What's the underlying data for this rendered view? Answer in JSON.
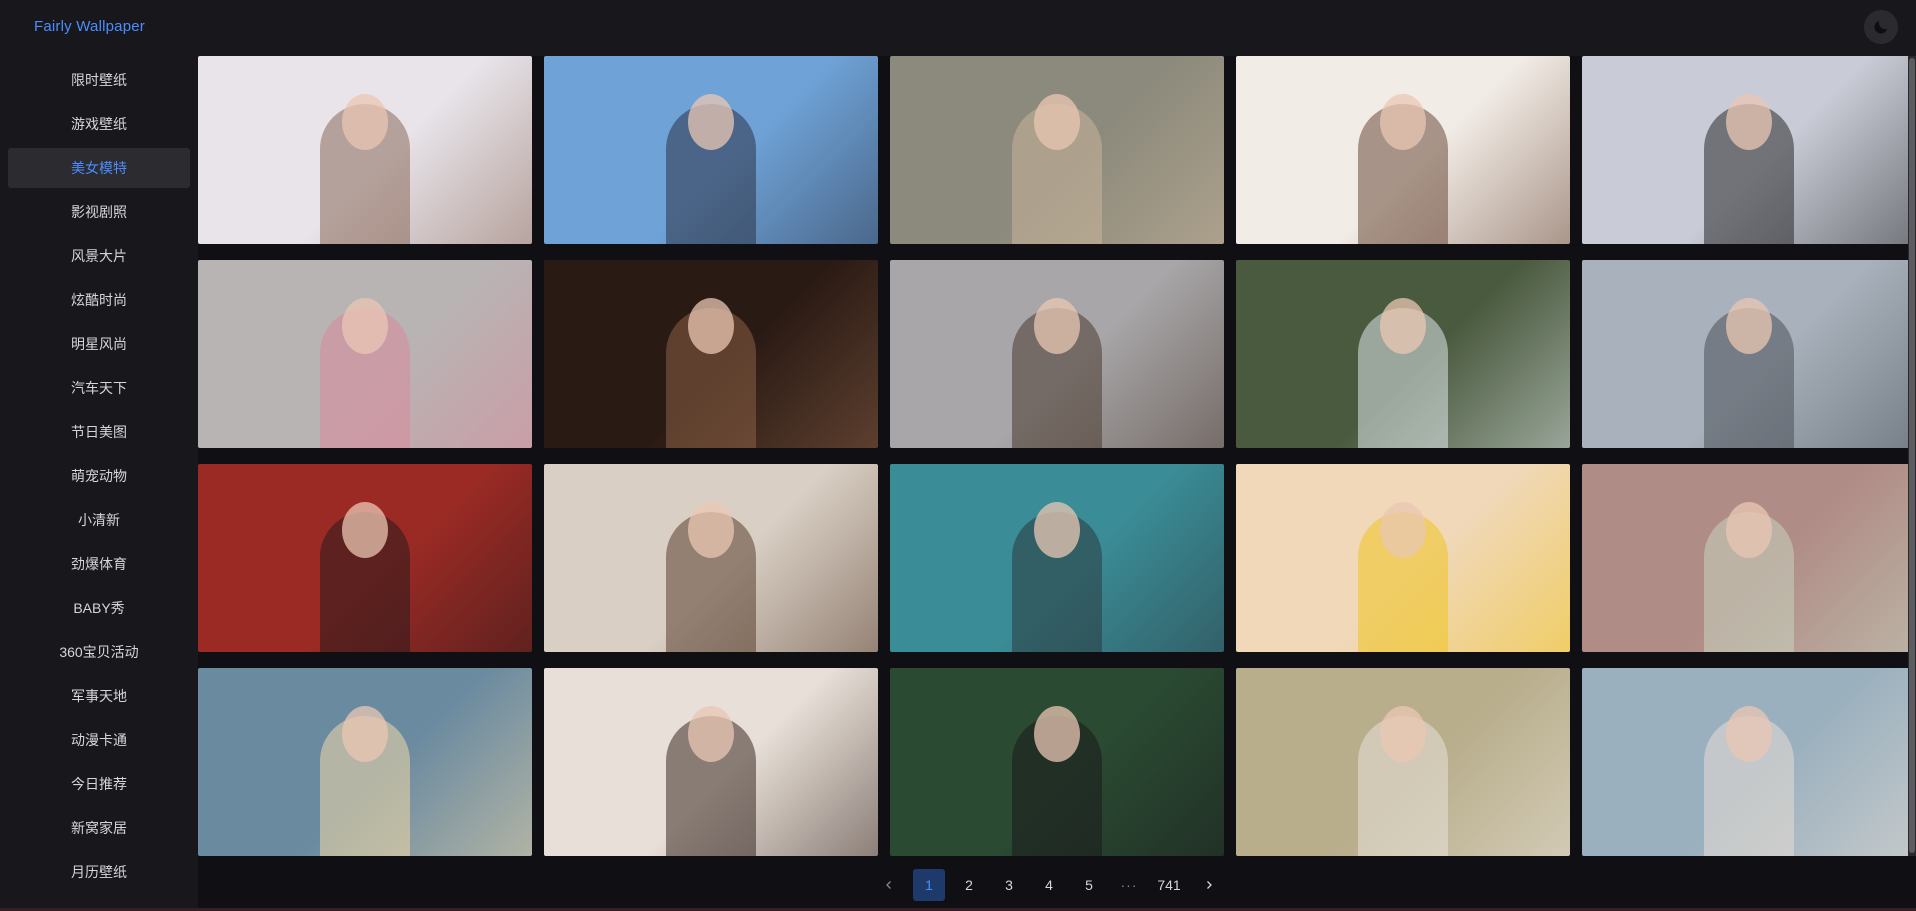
{
  "header": {
    "brand": "Fairly Wallpaper",
    "theme_icon": "moon-icon"
  },
  "sidebar": {
    "active_index": 2,
    "items": [
      {
        "label": "限时壁纸"
      },
      {
        "label": "游戏壁纸"
      },
      {
        "label": "美女模特"
      },
      {
        "label": "影视剧照"
      },
      {
        "label": "风景大片"
      },
      {
        "label": "炫酷时尚"
      },
      {
        "label": "明星风尚"
      },
      {
        "label": "汽车天下"
      },
      {
        "label": "节日美图"
      },
      {
        "label": "萌宠动物"
      },
      {
        "label": "小清新"
      },
      {
        "label": "劲爆体育"
      },
      {
        "label": "BABY秀"
      },
      {
        "label": "360宝贝活动"
      },
      {
        "label": "军事天地"
      },
      {
        "label": "动漫卡通"
      },
      {
        "label": "今日推荐"
      },
      {
        "label": "新窝家居"
      },
      {
        "label": "月历壁纸"
      }
    ]
  },
  "gallery": {
    "thumbnails": [
      {
        "bg": "#e8e4ea",
        "accent": "#8b6a5a"
      },
      {
        "bg": "#6fa3d8",
        "accent": "#2b3346"
      },
      {
        "bg": "#8c8a7c",
        "accent": "#c9b49a"
      },
      {
        "bg": "#f2ece6",
        "accent": "#6b4a3a"
      },
      {
        "bg": "#c9ccd6",
        "accent": "#2a2a2e"
      },
      {
        "bg": "#b8b4b4",
        "accent": "#d98a9a"
      },
      {
        "bg": "#2a1a14",
        "accent": "#8a6046"
      },
      {
        "bg": "#a8a6a8",
        "accent": "#4a3a30"
      },
      {
        "bg": "#4a5a3e",
        "accent": "#dfe8ea"
      },
      {
        "bg": "#a9b2bc",
        "accent": "#4a5058"
      },
      {
        "bg": "#9c2a24",
        "accent": "#2a1a1c"
      },
      {
        "bg": "#d9cfc4",
        "accent": "#5a4030"
      },
      {
        "bg": "#3a8c96",
        "accent": "#2c3a40"
      },
      {
        "bg": "#f0d8b8",
        "accent": "#f0c420"
      },
      {
        "bg": "#b08c86",
        "accent": "#c6d4c0"
      },
      {
        "bg": "#6a8aa0",
        "accent": "#f0d8a8"
      },
      {
        "bg": "#e8e0d8",
        "accent": "#3a2a24"
      },
      {
        "bg": "#2a4a32",
        "accent": "#1a1a1c"
      },
      {
        "bg": "#b8ae8c",
        "accent": "#e8e2d8"
      },
      {
        "bg": "#9ab0be",
        "accent": "#e8ddd4"
      }
    ]
  },
  "pagination": {
    "prev_icon": "chevron-left-icon",
    "pages": [
      "1",
      "2",
      "3",
      "4",
      "5"
    ],
    "current": "1",
    "ellipsis": "···",
    "last": "741",
    "next_icon": "chevron-right-icon"
  },
  "colors": {
    "accent": "#4b8dff",
    "background": "#18181c",
    "content_background": "#101014"
  }
}
